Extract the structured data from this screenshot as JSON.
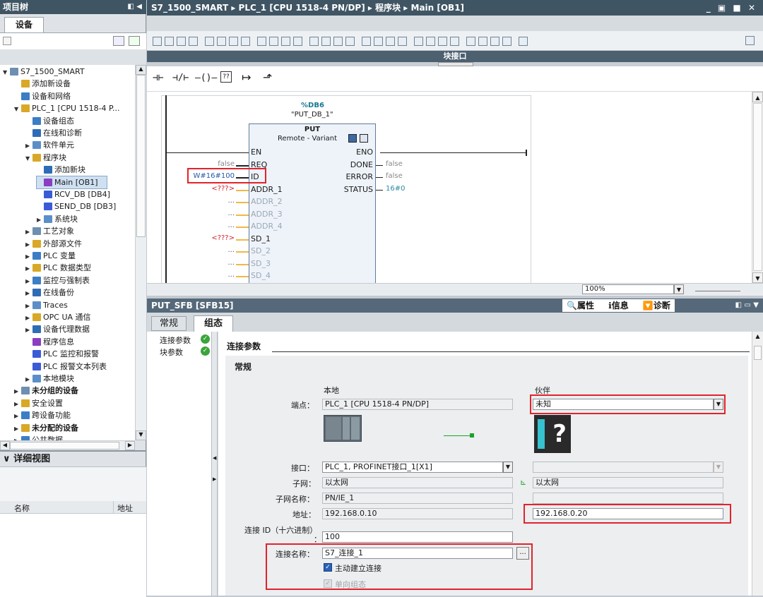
{
  "project_tree": {
    "title": "项目树",
    "tab": "设备",
    "items": [
      {
        "label": "S7_1500_SMART",
        "indent": 0,
        "toggle": "▼",
        "bold": false
      },
      {
        "label": "添加新设备",
        "indent": 1,
        "toggle": "",
        "bold": false
      },
      {
        "label": "设备和网络",
        "indent": 1,
        "toggle": "",
        "bold": false
      },
      {
        "label": "PLC_1 [CPU 1518-4 P...",
        "indent": 1,
        "toggle": "▼",
        "bold": false
      },
      {
        "label": "设备组态",
        "indent": 2,
        "toggle": "",
        "bold": false
      },
      {
        "label": "在线和诊断",
        "indent": 2,
        "toggle": "",
        "bold": false
      },
      {
        "label": "软件单元",
        "indent": 2,
        "toggle": "▶",
        "bold": false
      },
      {
        "label": "程序块",
        "indent": 2,
        "toggle": "▼",
        "bold": false
      },
      {
        "label": "添加新块",
        "indent": 3,
        "toggle": "",
        "bold": false
      },
      {
        "label": "Main [OB1]",
        "indent": 3,
        "toggle": "",
        "bold": false,
        "selected": true
      },
      {
        "label": "RCV_DB [DB4]",
        "indent": 3,
        "toggle": "",
        "bold": false
      },
      {
        "label": "SEND_DB [DB3]",
        "indent": 3,
        "toggle": "",
        "bold": false
      },
      {
        "label": "系统块",
        "indent": 3,
        "toggle": "▶",
        "bold": false
      },
      {
        "label": "工艺对象",
        "indent": 2,
        "toggle": "▶",
        "bold": false
      },
      {
        "label": "外部源文件",
        "indent": 2,
        "toggle": "▶",
        "bold": false
      },
      {
        "label": "PLC 变量",
        "indent": 2,
        "toggle": "▶",
        "bold": false
      },
      {
        "label": "PLC 数据类型",
        "indent": 2,
        "toggle": "▶",
        "bold": false
      },
      {
        "label": "监控与强制表",
        "indent": 2,
        "toggle": "▶",
        "bold": false
      },
      {
        "label": "在线备份",
        "indent": 2,
        "toggle": "▶",
        "bold": false
      },
      {
        "label": "Traces",
        "indent": 2,
        "toggle": "▶",
        "bold": false
      },
      {
        "label": "OPC UA 通信",
        "indent": 2,
        "toggle": "▶",
        "bold": false
      },
      {
        "label": "设备代理数据",
        "indent": 2,
        "toggle": "▶",
        "bold": false
      },
      {
        "label": "程序信息",
        "indent": 2,
        "toggle": "",
        "bold": false
      },
      {
        "label": "PLC 监控和报警",
        "indent": 2,
        "toggle": "",
        "bold": false
      },
      {
        "label": "PLC 报警文本列表",
        "indent": 2,
        "toggle": "",
        "bold": false
      },
      {
        "label": "本地模块",
        "indent": 2,
        "toggle": "▶",
        "bold": false
      },
      {
        "label": "未分组的设备",
        "indent": 1,
        "toggle": "▶",
        "bold": true
      },
      {
        "label": "安全设置",
        "indent": 1,
        "toggle": "▶",
        "bold": false
      },
      {
        "label": "跨设备功能",
        "indent": 1,
        "toggle": "▶",
        "bold": false
      },
      {
        "label": "未分配的设备",
        "indent": 1,
        "toggle": "▶",
        "bold": true
      },
      {
        "label": "公共数据",
        "indent": 1,
        "toggle": "▶",
        "bold": false
      }
    ]
  },
  "detail_view": {
    "title": "详细视图",
    "col_name": "名称",
    "col_address": "地址"
  },
  "editor": {
    "breadcrumb": [
      "S7_1500_SMART",
      "PLC_1 [CPU 1518-4 PN/DP]",
      "程序块",
      "Main [OB1]"
    ],
    "interface_label": "块接口",
    "zoom": "100%",
    "block": {
      "db_address": "%DB6",
      "db_name": "\"PUT_DB_1\"",
      "name": "PUT",
      "mode": "Remote - Variant",
      "inputs": [
        {
          "pin": "EN",
          "value": ""
        },
        {
          "pin": "REQ",
          "value": "false"
        },
        {
          "pin": "ID",
          "value": "W#16#100"
        },
        {
          "pin": "ADDR_1",
          "value": "<???>"
        },
        {
          "pin": "ADDR_2",
          "value": "..."
        },
        {
          "pin": "ADDR_3",
          "value": "..."
        },
        {
          "pin": "ADDR_4",
          "value": "..."
        },
        {
          "pin": "SD_1",
          "value": "<???>"
        },
        {
          "pin": "SD_2",
          "value": "..."
        },
        {
          "pin": "SD_3",
          "value": "..."
        },
        {
          "pin": "SD_4",
          "value": "..."
        }
      ],
      "outputs": [
        {
          "pin": "ENO",
          "value": ""
        },
        {
          "pin": "DONE",
          "value": "false"
        },
        {
          "pin": "ERROR",
          "value": "false"
        },
        {
          "pin": "STATUS",
          "value": "16#0"
        }
      ]
    }
  },
  "inspector": {
    "title": "PUT_SFB [SFB15]",
    "right_tabs": [
      "属性",
      "信息",
      "诊断"
    ],
    "tabs": [
      "常规",
      "组态"
    ],
    "side_items": [
      "连接参数",
      "块参数"
    ],
    "section": "连接参数",
    "subsection": "常规",
    "local_header": "本地",
    "partner_header": "伙伴",
    "endpoint_label": "端点：",
    "local_endpoint": "PLC_1 [CPU 1518-4 PN/DP]",
    "partner_endpoint": "未知",
    "interface_label": "接口：",
    "local_interface": "PLC_1, PROFINET接口_1[X1]",
    "partner_interface": "",
    "subnet_label": "子网：",
    "local_subnet": "以太网",
    "partner_subnet": "以太网",
    "subnet_name_label": "子网名称：",
    "local_subnet_name": "PN/IE_1",
    "partner_subnet_name": "",
    "address_label": "地址：",
    "local_address": "192.168.0.10",
    "partner_address": "192.168.0.20",
    "conn_id_label": "连接 ID（十六进制）",
    "conn_id_colon": "：",
    "conn_id": "100",
    "conn_name_label": "连接名称：",
    "conn_name": "S7_连接_1",
    "active_conn": "主动建立连接",
    "oneway": "单向组态"
  }
}
